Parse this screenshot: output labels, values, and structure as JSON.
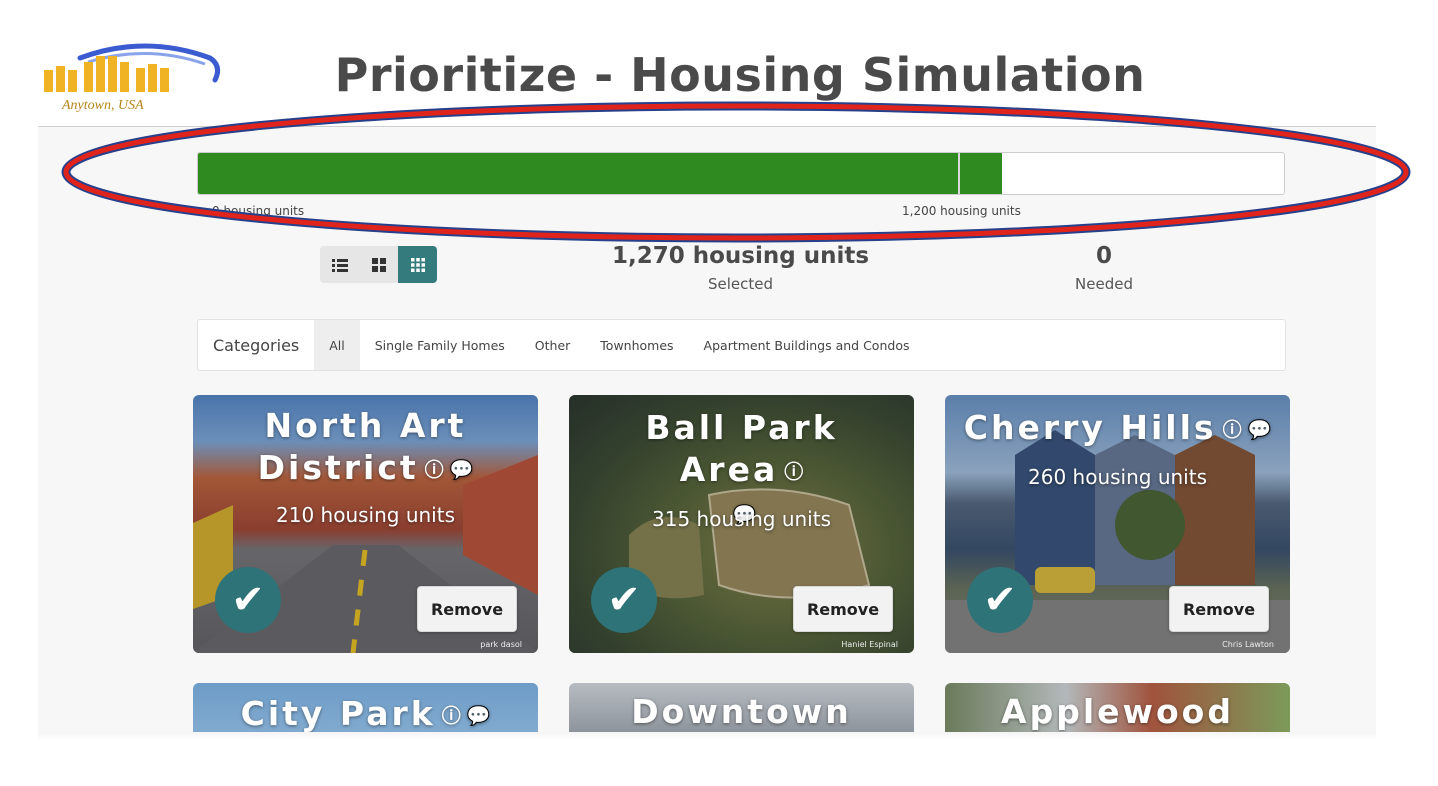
{
  "header": {
    "logo_place": "Anytown, USA",
    "title": "Prioritize - Housing Simulation"
  },
  "progress": {
    "min_label": "0 housing units",
    "target_label": "1,200 housing units",
    "selected_fraction": 0.74,
    "target_fraction": 0.7,
    "fill_color": "#2f8a1f"
  },
  "view_toggle": {
    "icons": [
      "list-view-icon",
      "medium-grid-icon",
      "small-grid-icon"
    ],
    "active": "small-grid-icon"
  },
  "stats": {
    "selected_value": "1,270 housing units",
    "selected_label": "Selected",
    "needed_value": "0",
    "needed_label": "Needed"
  },
  "categories": {
    "title": "Categories",
    "tabs": [
      "All",
      "Single Family Homes",
      "Other",
      "Townhomes",
      "Apartment Buildings and Condos"
    ],
    "active": "All"
  },
  "cards": [
    {
      "title": "North Art District",
      "units": "210 housing units",
      "action": "Remove",
      "credit": "park dasol"
    },
    {
      "title": "Ball Park Area",
      "units": "315 housing units",
      "action": "Remove",
      "credit": "Haniel Espinal"
    },
    {
      "title": "Cherry Hills",
      "units": "260 housing units",
      "action": "Remove",
      "credit": "Chris Lawton"
    },
    {
      "title": "City Park"
    },
    {
      "title": "Downtown Area"
    },
    {
      "title": "Applewood"
    }
  ],
  "colors": {
    "accent": "#347b7d",
    "check": "#2e7377",
    "annotation_red": "#e0241c",
    "annotation_blue": "#27408b"
  }
}
